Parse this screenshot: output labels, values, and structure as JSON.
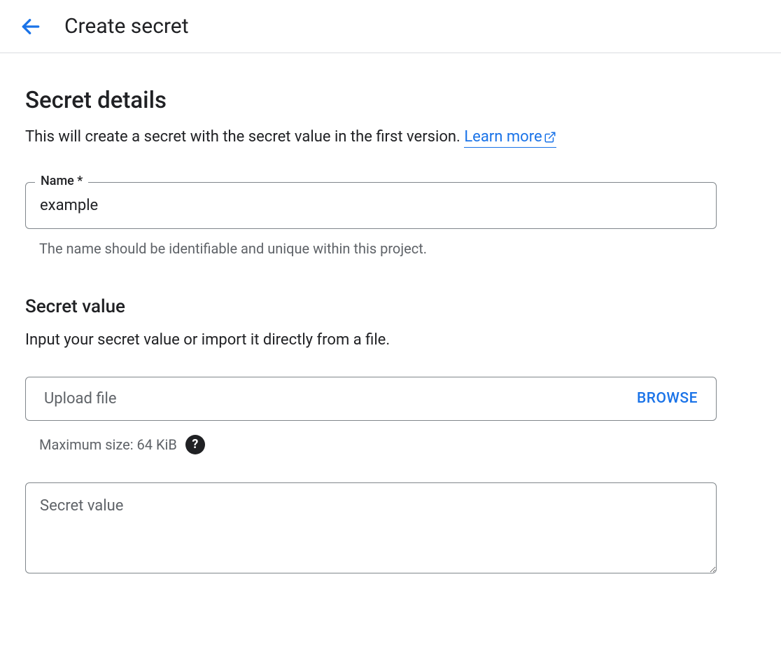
{
  "header": {
    "title": "Create secret"
  },
  "details": {
    "section_title": "Secret details",
    "description": "This will create a secret with the secret value in the first version. ",
    "learn_more": "Learn more",
    "name_label": "Name *",
    "name_value": "example",
    "name_helper": "The name should be identifiable and unique within this project."
  },
  "secret_value": {
    "subsection_title": "Secret value",
    "subsection_desc": "Input your secret value or import it directly from a file.",
    "upload_placeholder": "Upload file",
    "browse_label": "BROWSE",
    "max_size": "Maximum size: 64 KiB",
    "textarea_placeholder": "Secret value",
    "textarea_value": ""
  }
}
